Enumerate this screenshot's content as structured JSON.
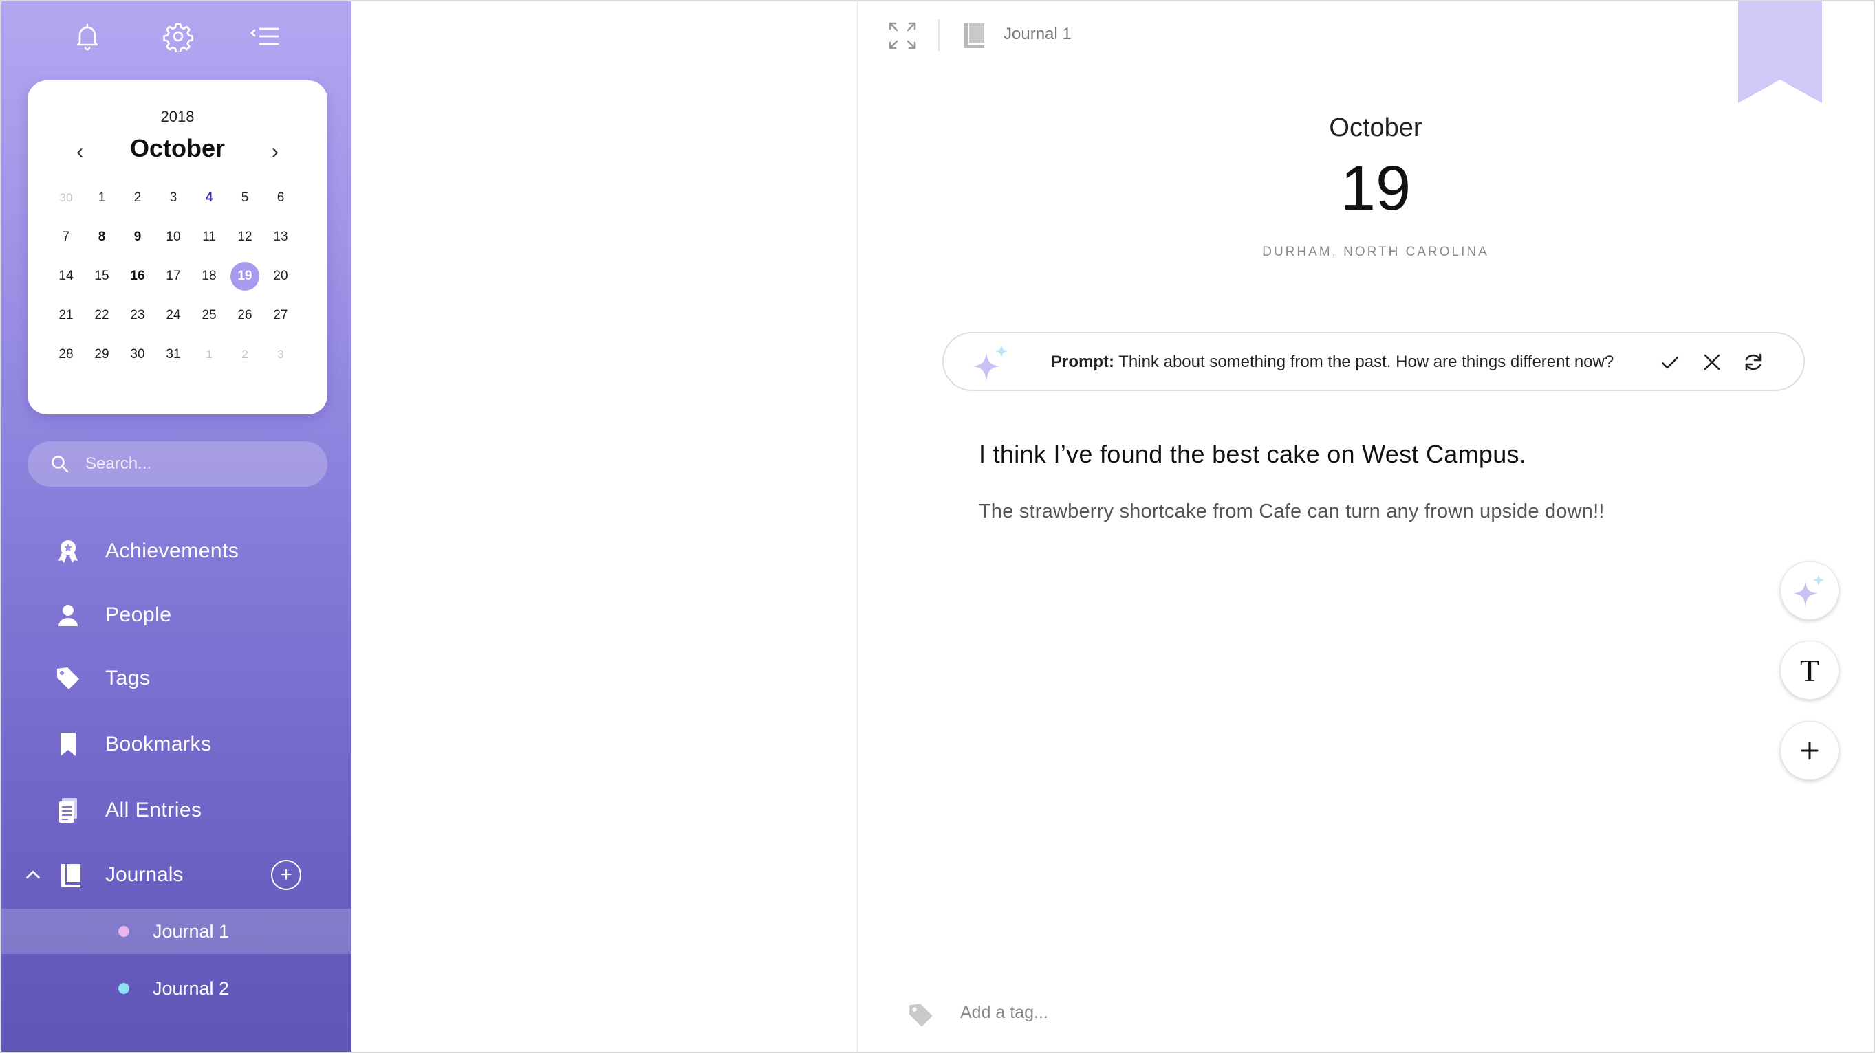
{
  "sidebar": {
    "top_icons": [
      "bell-icon",
      "gear-icon",
      "collapse-menu-icon"
    ],
    "calendar": {
      "year": "2018",
      "month": "October",
      "prev_glyph": "‹",
      "next_glyph": "›",
      "weeks": [
        [
          {
            "d": "30",
            "s": "muted"
          },
          {
            "d": "1"
          },
          {
            "d": "2"
          },
          {
            "d": "3"
          },
          {
            "d": "4",
            "s": "accent"
          },
          {
            "d": "5"
          },
          {
            "d": "6"
          }
        ],
        [
          {
            "d": "7"
          },
          {
            "d": "8",
            "s": "bold"
          },
          {
            "d": "9",
            "s": "bold"
          },
          {
            "d": "10"
          },
          {
            "d": "11"
          },
          {
            "d": "12"
          },
          {
            "d": "13"
          }
        ],
        [
          {
            "d": "14"
          },
          {
            "d": "15"
          },
          {
            "d": "16",
            "s": "bold"
          },
          {
            "d": "17"
          },
          {
            "d": "18"
          },
          {
            "d": "19",
            "s": "selected"
          },
          {
            "d": "20"
          }
        ],
        [
          {
            "d": "21"
          },
          {
            "d": "22"
          },
          {
            "d": "23"
          },
          {
            "d": "24"
          },
          {
            "d": "25"
          },
          {
            "d": "26"
          },
          {
            "d": "27"
          }
        ],
        [
          {
            "d": "28"
          },
          {
            "d": "29"
          },
          {
            "d": "30"
          },
          {
            "d": "31"
          },
          {
            "d": "1",
            "s": "muted"
          },
          {
            "d": "2",
            "s": "muted"
          },
          {
            "d": "3",
            "s": "muted"
          }
        ]
      ]
    },
    "search_placeholder": "Search...",
    "nav": [
      {
        "label": "Achievements",
        "icon": "award-icon"
      },
      {
        "label": "People",
        "icon": "person-icon"
      },
      {
        "label": "Tags",
        "icon": "tag-icon"
      },
      {
        "label": "Bookmarks",
        "icon": "bookmark-icon"
      },
      {
        "label": "All Entries",
        "icon": "entries-icon"
      }
    ],
    "journals": {
      "label": "Journals",
      "add_glyph": "+",
      "items": [
        {
          "label": "Journal 1",
          "dot_color": "#e7b5ef",
          "active": true
        },
        {
          "label": "Journal 2",
          "dot_color": "#8fe0f5",
          "active": false
        }
      ]
    }
  },
  "editor": {
    "toolbar": {
      "journal_name": "Journal 1"
    },
    "date": {
      "month": "October",
      "day": "19",
      "location": "DURHAM, NORTH CAROLINA"
    },
    "prompt": {
      "label": "Prompt:",
      "text": " Think about something from the past. How are things different now?",
      "actions": [
        "accept-icon",
        "dismiss-icon",
        "refresh-icon"
      ]
    },
    "entry": {
      "title": "I think I’ve found the best cake on West Campus.",
      "body": "The strawberry shortcake from Cafe can turn any frown upside down!!"
    },
    "fabs": {
      "text_glyph": "T",
      "add_glyph": "+"
    },
    "tag_placeholder": "Add a tag..."
  },
  "colors": {
    "accent": "#a99af0",
    "sidebar_top": "#b4a7f1",
    "sidebar_bottom": "#5f55b6"
  }
}
